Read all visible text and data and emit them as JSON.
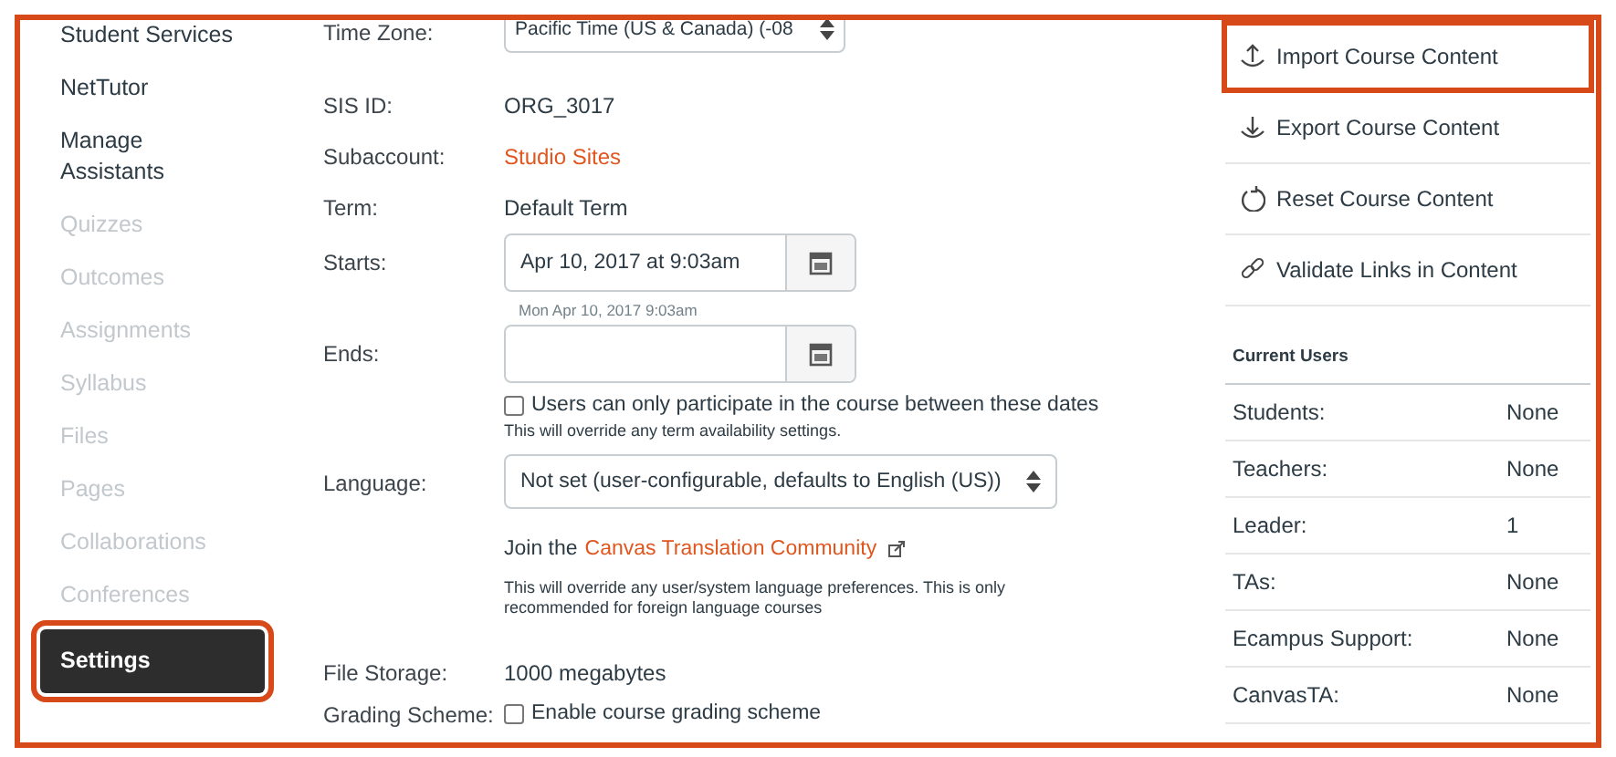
{
  "course_nav": [
    {
      "label": "Student Services",
      "disabled": false,
      "selected": false,
      "highlighted": false
    },
    {
      "label": "NetTutor",
      "disabled": false,
      "selected": false,
      "highlighted": false
    },
    {
      "label": "Manage Assistants",
      "disabled": false,
      "selected": false,
      "highlighted": false
    },
    {
      "label": "Quizzes",
      "disabled": true,
      "selected": false,
      "highlighted": false
    },
    {
      "label": "Outcomes",
      "disabled": true,
      "selected": false,
      "highlighted": false
    },
    {
      "label": "Assignments",
      "disabled": true,
      "selected": false,
      "highlighted": false
    },
    {
      "label": "Syllabus",
      "disabled": true,
      "selected": false,
      "highlighted": false
    },
    {
      "label": "Files",
      "disabled": true,
      "selected": false,
      "highlighted": false
    },
    {
      "label": "Pages",
      "disabled": true,
      "selected": false,
      "highlighted": false
    },
    {
      "label": "Collaborations",
      "disabled": true,
      "selected": false,
      "highlighted": false
    },
    {
      "label": "Conferences",
      "disabled": true,
      "selected": false,
      "highlighted": false
    },
    {
      "label": "Settings",
      "disabled": false,
      "selected": true,
      "highlighted": true
    }
  ],
  "settings_form": [
    {
      "kind": "select",
      "label": "Time Zone:",
      "value": "Pacific Time (US & Canada) (-08"
    },
    {
      "kind": "text",
      "label": "SIS ID:",
      "value": "ORG_3017"
    },
    {
      "kind": "link",
      "label": "Subaccount:",
      "value": "Studio Sites"
    },
    {
      "kind": "text",
      "label": "Term:",
      "value": "Default Term"
    },
    {
      "kind": "date",
      "label": "Starts:",
      "value": "Apr 10, 2017 at  9:03am",
      "hint": "Mon Apr 10, 2017 9:03am"
    },
    {
      "kind": "date",
      "label": "Ends:"
    },
    {
      "kind": "checkbox",
      "option": "Users can only participate in the course between these dates",
      "checked": false,
      "note": "This will override any term availability settings."
    },
    {
      "kind": "select",
      "label": "Language:",
      "value": "Not set (user-configurable, defaults to English (US))"
    },
    {
      "kind": "join",
      "prefix": "Join the",
      "link": "Canvas Translation Community",
      "note": "This will override any user/system language preferences. This is only recommended for foreign language courses"
    },
    {
      "kind": "text",
      "label": "File Storage:",
      "value": "1000 megabytes"
    },
    {
      "kind": "checkbox",
      "label": "Grading Scheme:",
      "option": "Enable course grading scheme",
      "checked": false
    }
  ],
  "actions": [
    {
      "kind": "import",
      "label": "Import Course Content",
      "highlighted": true
    },
    {
      "kind": "export",
      "label": "Export Course Content",
      "highlighted": false
    },
    {
      "kind": "reset",
      "label": "Reset Course Content",
      "highlighted": false
    },
    {
      "kind": "validate",
      "label": "Validate Links in Content",
      "highlighted": false
    }
  ],
  "current_users": {
    "title": "Current Users",
    "rows": [
      {
        "role": "Students:",
        "count": "None"
      },
      {
        "role": "Teachers:",
        "count": "None"
      },
      {
        "role": "Leader:",
        "count": "1"
      },
      {
        "role": "TAs:",
        "count": "None"
      },
      {
        "role": "Ecampus Support:",
        "count": "None"
      },
      {
        "role": "CanvasTA:",
        "count": "None"
      }
    ]
  }
}
